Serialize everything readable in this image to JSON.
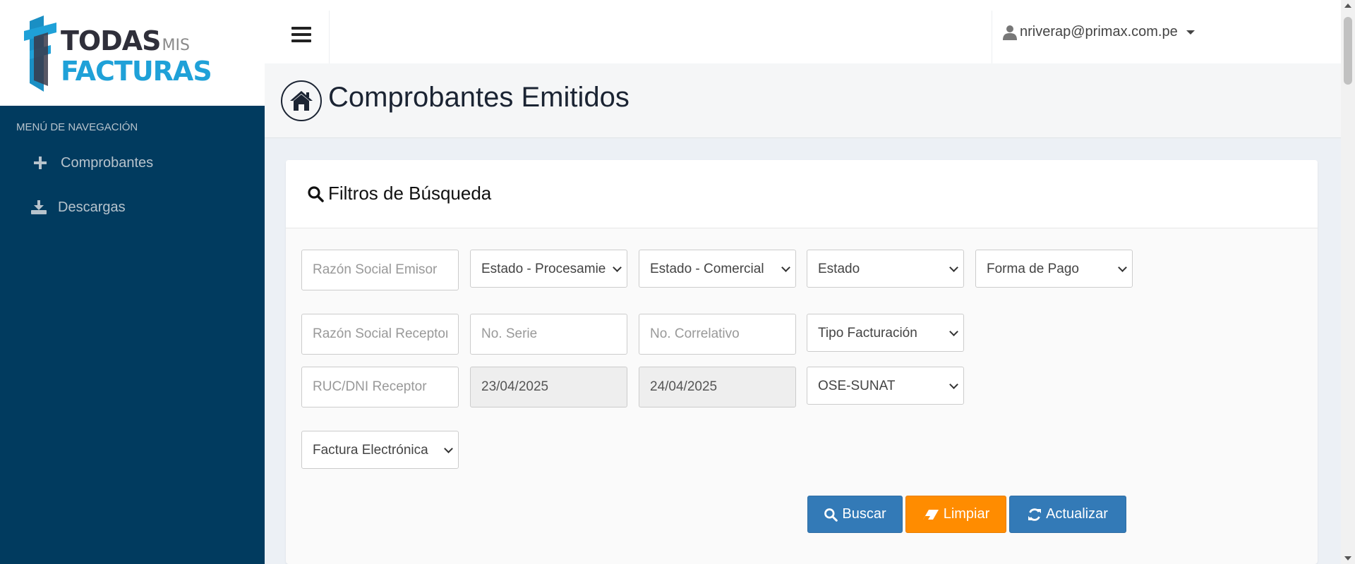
{
  "logo": {
    "line1": "TODAS",
    "line1_small": "MIS",
    "line2": "FACTURAS",
    "colors": {
      "dark": "#2f2f3a",
      "blue": "#1fa1d8"
    }
  },
  "sidebar": {
    "header": "MENÚ DE NAVEGACIÓN",
    "items": [
      {
        "label": "Comprobantes",
        "icon": "plus-icon"
      },
      {
        "label": "Descargas",
        "icon": "download-icon"
      }
    ],
    "bg_color": "#013b5f"
  },
  "topbar": {
    "user_email": "nriverap@primax.com.pe",
    "user_icon": "user-icon"
  },
  "page": {
    "title": "Comprobantes Emitidos",
    "home_icon": "home-icon"
  },
  "filters": {
    "title": "Filtros de Búsqueda",
    "razon_social_emisor_placeholder": "Razón Social Emisor",
    "estado_procesamiento": "Estado - Procesamiento",
    "estado_comercial": "Estado - Comercial",
    "estado": "Estado",
    "forma_pago": "Forma de Pago",
    "razon_social_receptor_placeholder": "Razón Social Receptor",
    "no_serie_placeholder": "No. Serie",
    "no_correlativo_placeholder": "No. Correlativo",
    "tipo_facturacion": "Tipo Facturación",
    "ruc_dni_receptor_placeholder": "RUC/DNI Receptor",
    "fecha_desde": "23/04/2025",
    "fecha_hasta": "24/04/2025",
    "ose_sunat": "OSE-SUNAT",
    "tipo_documento": "Factura Electrónica"
  },
  "actions": {
    "buscar": "Buscar",
    "limpiar": "Limpiar",
    "actualizar": "Actualizar",
    "colors": {
      "primary": "#337ab7",
      "warning": "#ff8c00"
    }
  }
}
